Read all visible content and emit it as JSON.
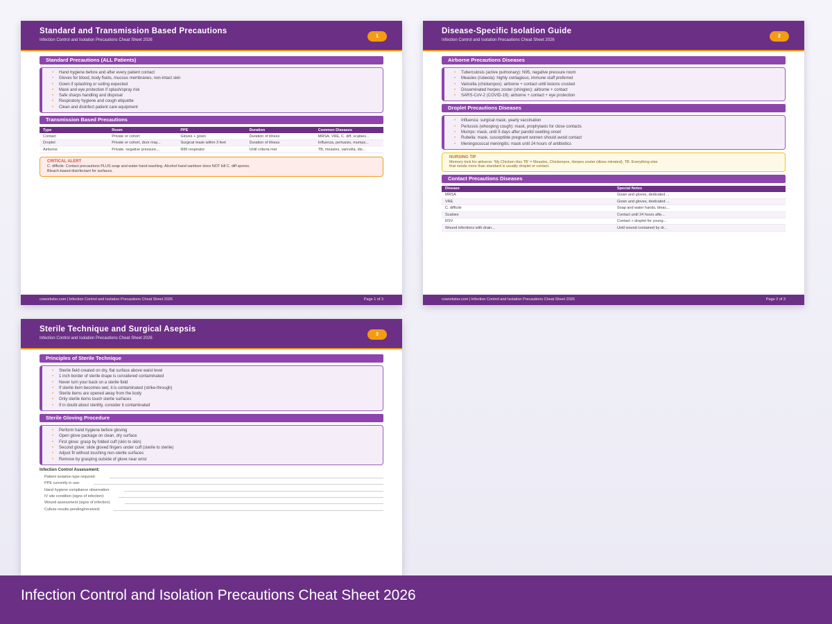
{
  "page1": {
    "title": "Standard and Transmission Based Precautions",
    "subtitle": "Infection Control and Isolation Precautions Cheat Sheet 2026",
    "badge": "1",
    "standard_heading": "Standard Precautions (ALL Patients)",
    "standard_items": [
      "Hand hygiene before and after every patient contact",
      "Gloves for blood, body fluids, mucous membranes, non-intact skin",
      "Gown if splashing or soiling expected",
      "Mask and eye protection if splash/spray risk",
      "Safe sharps handling and disposal",
      "Respiratory hygiene and cough etiquette",
      "Clean and disinfect patient care equipment"
    ],
    "transmission_heading": "Transmission Based Precautions",
    "transmission_table": {
      "headers": [
        "Type",
        "Room",
        "PPE",
        "Duration",
        "Common Diseases"
      ],
      "rows": [
        [
          "Contact",
          "Private or cohort",
          "Gloves + gown",
          "Duration of illness",
          "MRSA, VRE, C. diff, scabies..."
        ],
        [
          "Droplet",
          "Private or cohort, door may...",
          "Surgical mask within 3 feet",
          "Duration of illness",
          "Influenza, pertussis, mumps..."
        ],
        [
          "Airborne",
          "Private, negative pressure,...",
          "N95 respirator",
          "Until criteria met",
          "TB, measles, varicella, dis..."
        ]
      ]
    },
    "alert_title": "CRITICAL ALERT",
    "alert_text": "C. difficile: Contact precautions PLUS soap and water hand washing. Alcohol hand sanitizer does NOT kill C. diff spores. Bleach-based disinfectant for surfaces.",
    "footer_left": "coworkster.com | Infection Control and Isolation Precautions Cheat Sheet 2026",
    "footer_right": "Page 1 of 3"
  },
  "page2": {
    "title": "Disease-Specific Isolation Guide",
    "subtitle": "Infection Control and Isolation Precautions Cheat Sheet 2026",
    "badge": "2",
    "airborne_heading": "Airborne Precautions Diseases",
    "airborne_items": [
      "Tuberculosis (active pulmonary): N95, negative pressure room",
      "Measles (rubeola): highly contagious, immune staff preferred",
      "Varicella (chickenpox): airborne + contact until lesions crusted",
      "Disseminated herpes zoster (shingles): airborne + contact",
      "SARS-CoV-2 (COVID-19): airborne + contact + eye protection"
    ],
    "droplet_heading": "Droplet Precautions Diseases",
    "droplet_items": [
      "Influenza: surgical mask, yearly vaccination",
      "Pertussis (whooping cough): mask, prophylaxis for close contacts",
      "Mumps: mask, until 5 days after parotid swelling onset",
      "Rubella: mask, susceptible pregnant women should avoid contact",
      "Meningococcal meningitis: mask until 24 hours of antibiotics"
    ],
    "tip_title": "NURSING TIP",
    "tip_text": "Memory trick for airborne: 'My Chicken Hez TB' = Measles, Chickenpox, Herpes zoster (disse minated), TB. Everything else that needs more than standard is usually droplet or contact.",
    "contact_heading": "Contact Precautions Diseases",
    "contact_table": {
      "headers": [
        "Disease",
        "Special Notes"
      ],
      "rows": [
        [
          "MRSA",
          "Gown and gloves, dedicated ..."
        ],
        [
          "VRE",
          "Gown and gloves, dedicated ..."
        ],
        [
          "C. difficile",
          "Soap and water hands, bleac..."
        ],
        [
          "Scabies",
          "Contact until 24 hours afte..."
        ],
        [
          "RSV",
          "Contact + droplet for young..."
        ],
        [
          "Wound infections with drain...",
          "Until wound contained by dr..."
        ]
      ]
    },
    "footer_left": "coworkster.com | Infection Control and Isolation Precautions Cheat Sheet 2026",
    "footer_right": "Page 2 of 3"
  },
  "page3": {
    "title": "Sterile Technique and Surgical Asepsis",
    "subtitle": "Infection Control and Isolation Precautions Cheat Sheet 2026",
    "badge": "3",
    "principles_heading": "Principles of Sterile Technique",
    "principles_items": [
      "Sterile field created on dry, flat surface above waist level",
      "1 inch border of sterile drape is considered contaminated",
      "Never turn your back on a sterile field",
      "If sterile item becomes wet, it is contaminated (strike-through)",
      "Sterile items are opened away from the body",
      "Only sterile items touch sterile surfaces",
      "If in doubt about sterility, consider it contaminated"
    ],
    "gloving_heading": "Sterile Gloving Procedure",
    "gloving_items": [
      "Perform hand hygiene before gloving",
      "Open glove package on clean, dry surface",
      "First glove: grasp by folded cuff (skin to skin)",
      "Second glove: slide gloved fingers under cuff (sterile to sterile)",
      "Adjust fit without touching non-sterile surfaces",
      "Remove by grasping outside of glove near wrist"
    ],
    "assessment_title": "Infection Control Assessment:",
    "assessment_fields": [
      "Patient isolation type required:",
      "PPE currently in use:",
      "Hand hygiene compliance observation:",
      "IV site condition (signs of infection):",
      "Wound assessment (signs of infection):",
      "Culture results pending/received:"
    ]
  },
  "banner": {
    "title": "Infection Control and Isolation Precautions Cheat Sheet 2026"
  },
  "colors": {
    "primary": "#6b2f85",
    "section": "#8e44ad",
    "accent": "#f39c12",
    "alert": "#e74c3c",
    "tip": "#f1c40f"
  }
}
